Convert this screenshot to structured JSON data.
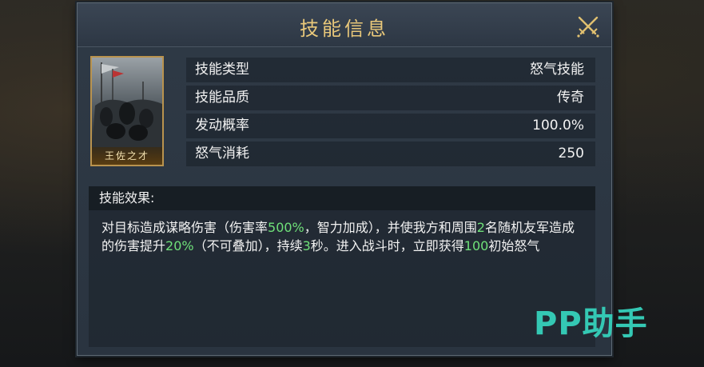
{
  "dialog": {
    "title": "技能信息"
  },
  "skill_card": {
    "name": "王佐之才"
  },
  "info_rows": [
    {
      "label": "技能类型",
      "value": "怒气技能"
    },
    {
      "label": "技能品质",
      "value": "传奇"
    },
    {
      "label": "发动概率",
      "value": "100.0%"
    },
    {
      "label": "怒气消耗",
      "value": "250"
    }
  ],
  "effect": {
    "heading": "技能效果:",
    "segments": [
      {
        "text": "对目标造成谋略伤害（伤害率",
        "highlight": false
      },
      {
        "text": "500%",
        "highlight": true
      },
      {
        "text": "，智力加成），并使我方和周围",
        "highlight": false
      },
      {
        "text": "2",
        "highlight": true
      },
      {
        "text": "名随机友军造成的伤害提升",
        "highlight": false
      },
      {
        "text": "20%",
        "highlight": true
      },
      {
        "text": "（不可叠加），持续",
        "highlight": false
      },
      {
        "text": "3",
        "highlight": true
      },
      {
        "text": "秒。进入战斗时，立即获得",
        "highlight": false
      },
      {
        "text": "100",
        "highlight": true
      },
      {
        "text": "初始怒气",
        "highlight": false
      }
    ]
  },
  "watermark": {
    "text": "PP助手"
  },
  "colors": {
    "title": "#e9c87a",
    "highlight": "#6fe079",
    "watermark": "#34c8b4",
    "card_border": "#b9934e"
  },
  "icons": {
    "close": "crossed-swords-close-icon"
  }
}
